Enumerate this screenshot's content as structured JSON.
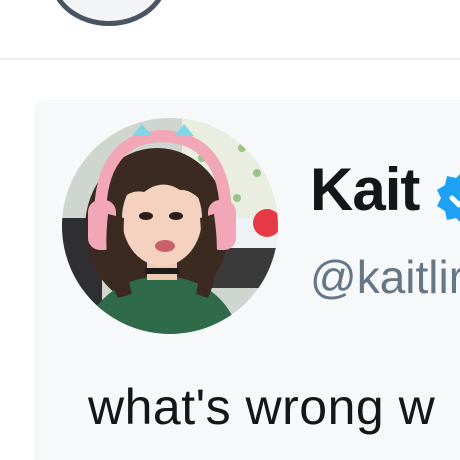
{
  "tweet": {
    "display_name": "Kait",
    "handle": "@kaitlir",
    "text": "what's wrong w",
    "verified": true
  },
  "icons": {
    "verified": "verified-badge-icon",
    "avatar": "profile-photo"
  },
  "colors": {
    "name_text": "#14171a",
    "handle_text": "#657786",
    "verified_blue": "#1da1f2",
    "card_background": "#f7f8fa"
  }
}
